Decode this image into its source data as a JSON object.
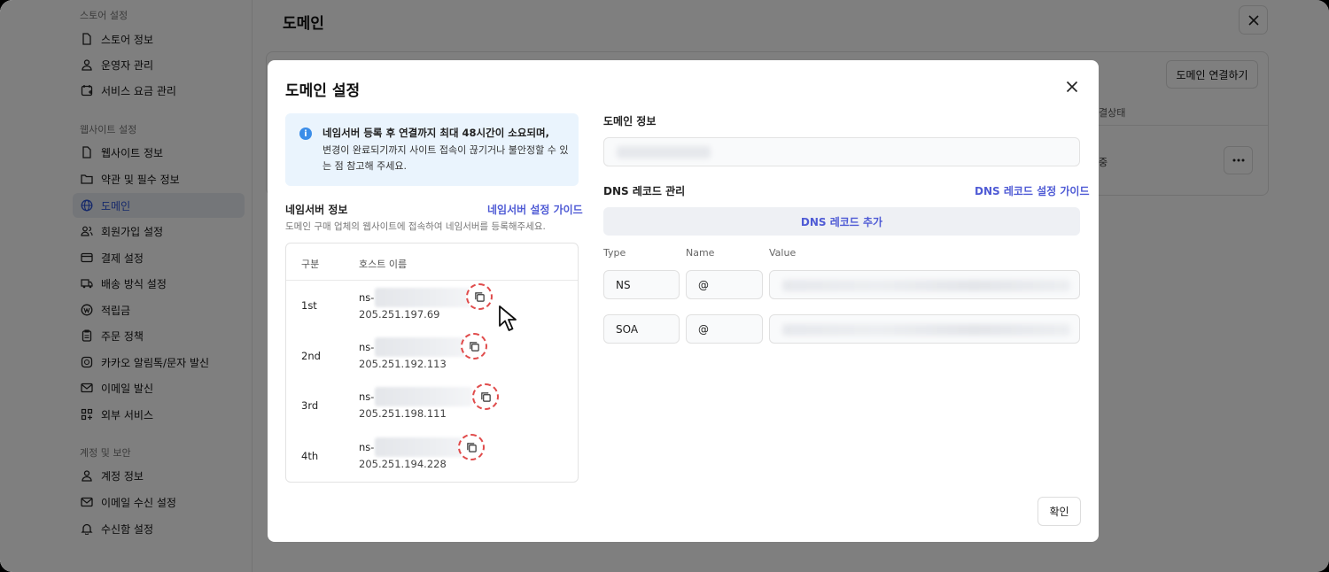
{
  "sidebar": {
    "sections": [
      {
        "label": "스토어 설정"
      },
      {
        "label": "웹사이트 설정"
      },
      {
        "label": "계정 및 보안"
      }
    ],
    "items": [
      {
        "label": "스토어 정보",
        "icon": "file-icon"
      },
      {
        "label": "운영자 관리",
        "icon": "user-icon"
      },
      {
        "label": "서비스 요금 관리",
        "icon": "calendar-plus-icon"
      },
      {
        "label": "웹사이트 정보",
        "icon": "file-icon"
      },
      {
        "label": "약관 및 필수 정보",
        "icon": "folder-icon"
      },
      {
        "label": "도메인",
        "icon": "globe-icon",
        "active": true
      },
      {
        "label": "회원가입 설정",
        "icon": "users-icon"
      },
      {
        "label": "결제 설정",
        "icon": "card-icon"
      },
      {
        "label": "배송 방식 설정",
        "icon": "truck-icon"
      },
      {
        "label": "적립금",
        "icon": "coin-icon"
      },
      {
        "label": "주문 정책",
        "icon": "clipboard-icon"
      },
      {
        "label": "카카오 알림톡/문자 발신",
        "icon": "chat-icon"
      },
      {
        "label": "이메일 발신",
        "icon": "mail-icon"
      },
      {
        "label": "외부 서비스",
        "icon": "apps-icon"
      },
      {
        "label": "계정 정보",
        "icon": "user-icon"
      },
      {
        "label": "이메일 수신 설정",
        "icon": "mail-icon"
      },
      {
        "label": "수신함 설정",
        "icon": "bell-icon"
      }
    ]
  },
  "main": {
    "title": "도메인",
    "connect_button": "도메인 연결하기",
    "column_status": "결상태",
    "row_status": "중"
  },
  "modal": {
    "title": "도메인 설정",
    "info": {
      "line1": "네임서버 등록 후 연결까지 최대 48시간이 소요되며,",
      "line2": "변경이 완료되기까지 사이트 접속이 끊기거나 불안정할 수 있는 점 참고해 주세요."
    },
    "nameserver": {
      "label": "네임서버 정보",
      "guide_link": "네임서버 설정 가이드",
      "subtitle": "도메인 구매 업체의 웹사이트에 접속하여 네임서버를 등록해주세요.",
      "header_col1": "구분",
      "header_col2": "호스트 이름",
      "rows": [
        {
          "label": "1st",
          "prefix": "ns-",
          "ip": "205.251.197.69"
        },
        {
          "label": "2nd",
          "prefix": "ns-",
          "ip": "205.251.192.113"
        },
        {
          "label": "3rd",
          "prefix": "ns-",
          "ip": "205.251.198.111"
        },
        {
          "label": "4th",
          "prefix": "ns-",
          "ip": "205.251.194.228"
        }
      ]
    },
    "domain_info_label": "도메인 정보",
    "dns": {
      "label": "DNS 레코드 관리",
      "guide_link": "DNS 레코드 설정 가이드",
      "add_button": "DNS 레코드 추가",
      "col_type": "Type",
      "col_name": "Name",
      "col_value": "Value",
      "records": [
        {
          "type": "NS",
          "name": "@"
        },
        {
          "type": "SOA",
          "name": "@"
        }
      ]
    },
    "confirm_button": "확인"
  }
}
